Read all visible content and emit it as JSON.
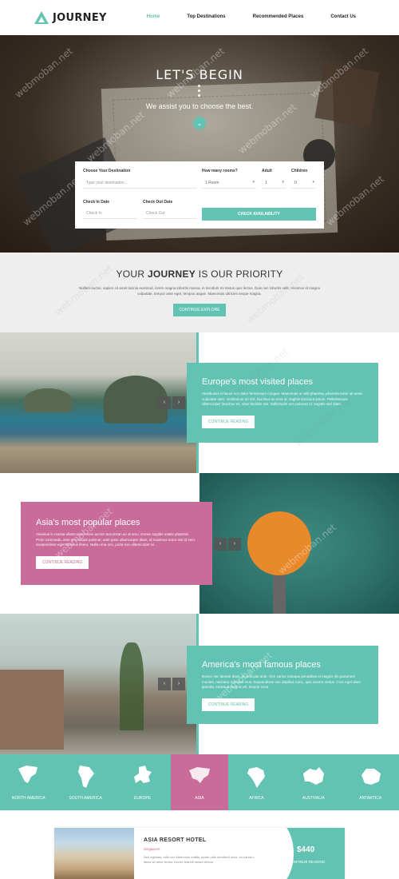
{
  "brand": {
    "name": "JOURNEY",
    "accent": "#62c3b2",
    "pink": "#c96c9a"
  },
  "nav": {
    "items": [
      {
        "label": "Home",
        "active": true
      },
      {
        "label": "Top Destinations",
        "active": false
      },
      {
        "label": "Recommended Places",
        "active": false
      },
      {
        "label": "Contact Us",
        "active": false
      }
    ]
  },
  "hero": {
    "title": "LET'S BEGIN",
    "subtitle": "We assist you to choose the best."
  },
  "booking": {
    "destination_label": "Choose Your Destination",
    "destination_placeholder": "Type your destination...",
    "rooms_label": "How many rooms?",
    "rooms_value": "1 Room",
    "adult_label": "Adult",
    "adult_value": "1",
    "children_label": "Children",
    "children_value": "0",
    "checkin_label": "Check In Date",
    "checkin_placeholder": "Check In",
    "checkout_label": "Check Out Date",
    "checkout_placeholder": "Check Out",
    "button": "CHECK AVAILABILITY"
  },
  "priority": {
    "title_pre": "YOUR ",
    "title_bold": "JOURNEY",
    "title_post": " IS OUR PRIORITY",
    "text": "Nullam auctor, sapien sit amet lacinia euismod, lorem magna lobortis massa, in tincidunt mi metus quis lectus. Duis nec lobortis velit. Vivamus id magna vulputate, tempor ante eget, tempus augue. Maecenas ultricies neque magna.",
    "button": "CONTINUE EXPLORE"
  },
  "features": [
    {
      "title": "Europe's most visited places",
      "text": "Vestibulum id lacus nec dolor fermentum congue. Maecenas ut velit pharetra, pharetra tortor sit amet, vulputate sem. Vestibulum mi nisl, faucibus ac eros id, sagittis tincidunt ipsum. Pellentesque ullamcorper faucibus mi, vitae facilisis nisi. Sollicitudin non pulvinar id, sagittis sed diam.",
      "button": "CONTINUE READING",
      "arrow_prev": "‹",
      "arrow_next": "›"
    },
    {
      "title": "Asia's most popular places",
      "text": "Vivamus in massa ullamcorper nunc auctor accumsan ac at arcu. Donec sagittis mattis pharetra. Proin commodo, ante et volutpat pulvinar, ante justo ullamcorper diam, id maximus tortor nisi id sem. Suspendisse eget rhoncus libero. Nulla urna orci, porta nec ullamcorper id.",
      "button": "CONTINUE READING",
      "arrow_prev": "‹",
      "arrow_next": "›"
    },
    {
      "title": "America's most famous places",
      "text": "Donec nec laoreet diam, at vehicula ante. Orci varius natoque penatibus et magnis dis parturient montes, nascetur ridiculus mus. Suspendisse nec dapibus nunc, quis viverra metus. Cras eget diam gravida, euismod magna vel, tempor urna.",
      "button": "CONTINUE READING",
      "arrow_prev": "‹",
      "arrow_next": "›"
    }
  ],
  "continents": [
    {
      "label": "NORTH AMERICA",
      "icon": "north-america-map-icon",
      "active": false
    },
    {
      "label": "SOUTH AMERICA",
      "icon": "south-america-map-icon",
      "active": false
    },
    {
      "label": "EUROPE",
      "icon": "europe-map-icon",
      "active": false
    },
    {
      "label": "ASIA",
      "icon": "asia-map-icon",
      "active": true
    },
    {
      "label": "AFRICA",
      "icon": "africa-map-icon",
      "active": false
    },
    {
      "label": "AUSTRALIA",
      "icon": "australia-map-icon",
      "active": false
    },
    {
      "label": "ANTARTICA",
      "icon": "antarctica-map-icon",
      "active": false
    }
  ],
  "hotel": {
    "name": "ASIA RESORT HOTEL",
    "location": "Singapore",
    "description": "Sed egestas, odio nec bibendum mattis, quam odio hendrerit risus, eu varius eros lacus sit amet lectus. Donec blandit luctus dictum.",
    "price": "$440",
    "button": "CONTINUE READING"
  },
  "watermark": "webmoban.net"
}
